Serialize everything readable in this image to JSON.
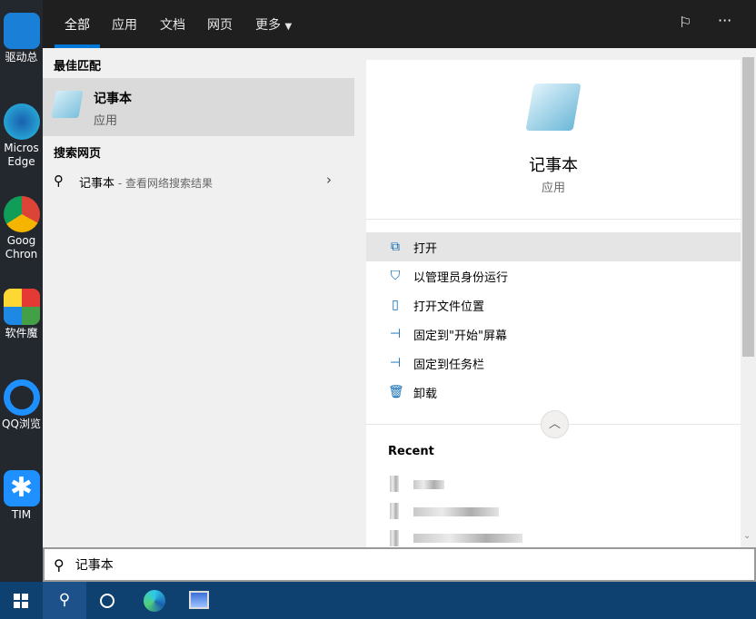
{
  "desktop": [
    {
      "label": "驱动总"
    },
    {
      "label": "Micros Edge"
    },
    {
      "label": "Goog Chron"
    },
    {
      "label": "软件魔"
    },
    {
      "label": "QQ浏览"
    },
    {
      "label": "TIM"
    }
  ],
  "tabs": [
    "全部",
    "应用",
    "文档",
    "网页",
    "更多"
  ],
  "best_match": {
    "header": "最佳匹配",
    "title": "记事本",
    "subtitle": "应用"
  },
  "web": {
    "header": "搜索网页",
    "query": "记事本",
    "suffix": " - 查看网络搜索结果"
  },
  "detail": {
    "title": "记事本",
    "subtitle": "应用",
    "actions": [
      "打开",
      "以管理员身份运行",
      "打开文件位置",
      "固定到\"开始\"屏幕",
      "固定到任务栏",
      "卸载"
    ],
    "recent_header": "Recent"
  },
  "search": {
    "value": "记事本"
  },
  "accent": "#0078d7"
}
